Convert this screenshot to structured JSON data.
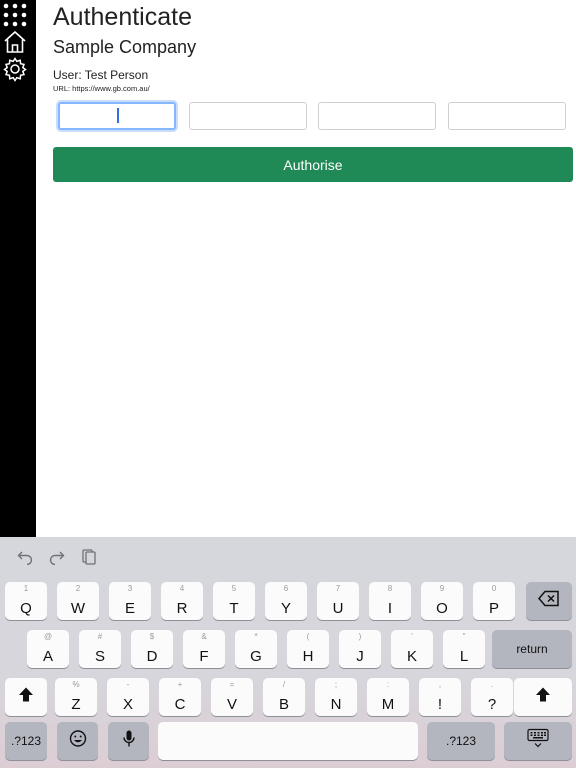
{
  "sidebar": {
    "items": [
      {
        "name": "apps-grid-icon"
      },
      {
        "name": "home-icon"
      },
      {
        "name": "gear-icon"
      }
    ]
  },
  "page": {
    "title": "Authenticate",
    "company": "Sample Company",
    "user_label": "User: Test Person",
    "url_label": "URL: https://www.gb.com.au/"
  },
  "code_inputs": [
    {
      "value": "",
      "focused": true
    },
    {
      "value": "",
      "focused": false
    },
    {
      "value": "",
      "focused": false
    },
    {
      "value": "",
      "focused": false
    }
  ],
  "authorise_label": "Authorise",
  "colors": {
    "sidebar": "#000000",
    "authorise_bg": "#208a57",
    "focus_ring": "#86b7fe"
  },
  "keyboard": {
    "toolbar": [
      "undo-icon",
      "redo-icon",
      "paste-icon"
    ],
    "row1": [
      {
        "main": "Q",
        "sub": "1"
      },
      {
        "main": "W",
        "sub": "2"
      },
      {
        "main": "E",
        "sub": "3"
      },
      {
        "main": "R",
        "sub": "4"
      },
      {
        "main": "T",
        "sub": "5"
      },
      {
        "main": "Y",
        "sub": "6"
      },
      {
        "main": "U",
        "sub": "7"
      },
      {
        "main": "I",
        "sub": "8"
      },
      {
        "main": "O",
        "sub": "9"
      },
      {
        "main": "P",
        "sub": "0"
      }
    ],
    "row2": [
      {
        "main": "A",
        "sub": "@"
      },
      {
        "main": "S",
        "sub": "#"
      },
      {
        "main": "D",
        "sub": "$"
      },
      {
        "main": "F",
        "sub": "&"
      },
      {
        "main": "G",
        "sub": "*"
      },
      {
        "main": "H",
        "sub": "("
      },
      {
        "main": "J",
        "sub": ")"
      },
      {
        "main": "K",
        "sub": "'"
      },
      {
        "main": "L",
        "sub": "\""
      }
    ],
    "row3": [
      {
        "main": "Z",
        "sub": "%"
      },
      {
        "main": "X",
        "sub": "-"
      },
      {
        "main": "C",
        "sub": "+"
      },
      {
        "main": "V",
        "sub": "="
      },
      {
        "main": "B",
        "sub": "/"
      },
      {
        "main": "N",
        "sub": ";"
      },
      {
        "main": "M",
        "sub": ":"
      },
      {
        "main": "!",
        "sub": ","
      },
      {
        "main": "?",
        "sub": "."
      }
    ],
    "return_label": "return",
    "numbers_label": ".?123",
    "numbers_label_right": ".?123"
  }
}
